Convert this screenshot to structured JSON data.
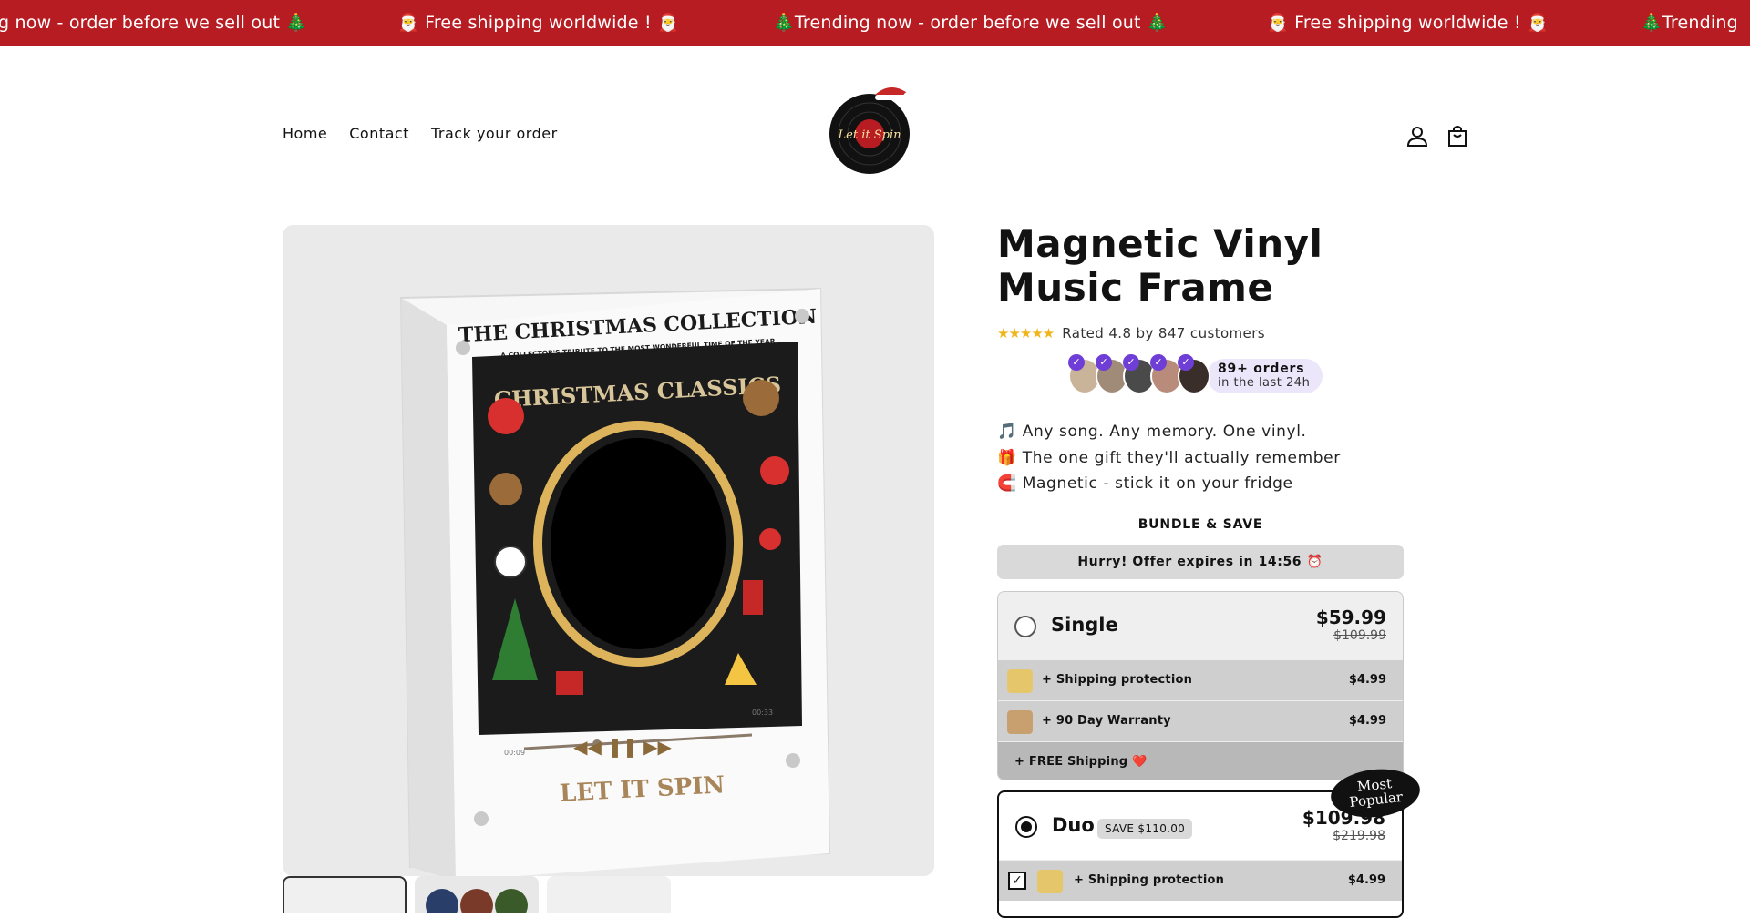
{
  "announcement": {
    "messages": [
      "g now - order before we sell out 🎄",
      "🎅 Free shipping worldwide ! 🎅",
      "🎄Trending now - order before we sell out 🎄",
      "🎅 Free shipping worldwide ! 🎅",
      "🎄Trending"
    ]
  },
  "nav": {
    "home": "Home",
    "contact": "Contact",
    "track": "Track your order"
  },
  "brand": {
    "logo_text": "Let it Spin"
  },
  "header_icons": {
    "account": "account-icon",
    "cart": "cart-icon"
  },
  "product": {
    "title": "Magnetic Vinyl Music Frame",
    "stars": "★★★★★",
    "rating_text": "Rated 4.8 by 847 customers",
    "orders_main": "89+ orders",
    "orders_sub": "in the last 24h",
    "bullets": [
      "🎵 Any song. Any memory. One vinyl.",
      "🎁 The one gift they'll actually remember",
      "🧲 Magnetic - stick it on your fridge"
    ]
  },
  "media": {
    "frame_title": "THE CHRISTMAS COLLECTION",
    "frame_subtitle": "A COLLECTOR'S TRIBUTE TO THE MOST WONDERFUL TIME OF THE YEAR",
    "classics": "CHRISTMAS CLASSICS",
    "time_start": "00:09",
    "time_end": "00:33",
    "footer": "LET IT SPIN"
  },
  "bundle": {
    "heading": "BUNDLE & SAVE",
    "hurry": "Hurry! Offer expires in 14:56 ⏰",
    "popular_badge_line1": "Most",
    "popular_badge_line2": "Popular",
    "single": {
      "name": "Single",
      "price": "$59.99",
      "was": "$109.99",
      "addon1_label": "+ Shipping protection",
      "addon1_price": "$4.99",
      "addon2_label": "+ 90 Day Warranty",
      "addon2_price": "$4.99",
      "free_label": "+ FREE Shipping ❤️"
    },
    "duo": {
      "name": "Duo",
      "save": "SAVE $110.00",
      "price": "$109.98",
      "was": "$219.98",
      "addon1_label": "+ Shipping protection",
      "addon1_price": "$4.99",
      "addon1_checked": "✓"
    }
  },
  "colors": {
    "announce_bg": "#b71c22",
    "accent": "#6e3ed7",
    "star": "#f0b51a"
  }
}
